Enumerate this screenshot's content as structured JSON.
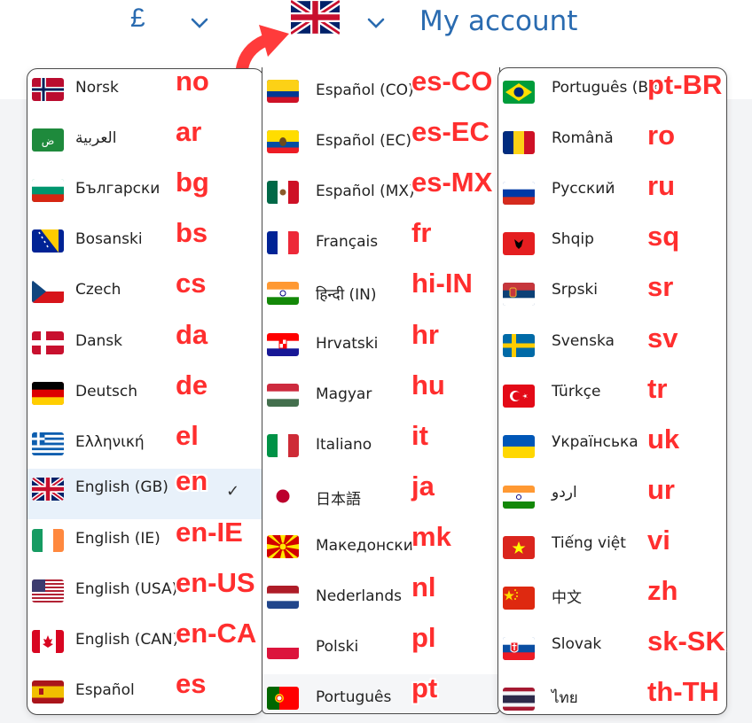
{
  "header": {
    "currency": "£",
    "account_label": "My account",
    "flag_icon": "uk-flag-icon",
    "accent_color": "#2a6bb0"
  },
  "annotation_color": "#ff2e2e",
  "columns": [
    {
      "items": [
        {
          "label": "Norsk",
          "code": "no",
          "flag": "no"
        },
        {
          "label": "العربية",
          "code": "ar",
          "flag": "ar"
        },
        {
          "label": "Български",
          "code": "bg",
          "flag": "bg"
        },
        {
          "label": "Bosanski",
          "code": "bs",
          "flag": "bs"
        },
        {
          "label": "Czech",
          "code": "cs",
          "flag": "cs"
        },
        {
          "label": "Dansk",
          "code": "da",
          "flag": "da"
        },
        {
          "label": "Deutsch",
          "code": "de",
          "flag": "de"
        },
        {
          "label": "Ελληνική",
          "code": "el",
          "flag": "el"
        },
        {
          "label": "English (GB)",
          "code": "en",
          "flag": "gb",
          "selected": true
        },
        {
          "label": "English (IE)",
          "code": "en-IE",
          "flag": "ie"
        },
        {
          "label": "English (USA)",
          "code": "en-US",
          "flag": "us"
        },
        {
          "label": "English (CAN)",
          "code": "en-CA",
          "flag": "ca"
        },
        {
          "label": "Español",
          "code": "es",
          "flag": "es"
        }
      ]
    },
    {
      "items": [
        {
          "label": "Español (CO)",
          "code": "es-CO",
          "flag": "co"
        },
        {
          "label": "Español (EC)",
          "code": "es-EC",
          "flag": "ec"
        },
        {
          "label": "Español (MX)",
          "code": "es-MX",
          "flag": "mx"
        },
        {
          "label": "Français",
          "code": "fr",
          "flag": "fr"
        },
        {
          "label": "हिन्दी (IN)",
          "code": "hi-IN",
          "flag": "in"
        },
        {
          "label": "Hrvatski",
          "code": "hr",
          "flag": "hr"
        },
        {
          "label": "Magyar",
          "code": "hu",
          "flag": "hu"
        },
        {
          "label": "Italiano",
          "code": "it",
          "flag": "it"
        },
        {
          "label": "日本語",
          "code": "ja",
          "flag": "jp"
        },
        {
          "label": "Македонски",
          "code": "mk",
          "flag": "mk"
        },
        {
          "label": "Nederlands",
          "code": "nl",
          "flag": "nl"
        },
        {
          "label": "Polski",
          "code": "pl",
          "flag": "pl"
        },
        {
          "label": "Português",
          "code": "pt",
          "flag": "pt",
          "hover": true
        }
      ]
    },
    {
      "items": [
        {
          "label": "Português (BR)",
          "code": "pt-BR",
          "flag": "br"
        },
        {
          "label": "Română",
          "code": "ro",
          "flag": "ro"
        },
        {
          "label": "Русский",
          "code": "ru",
          "flag": "ru"
        },
        {
          "label": "Shqip",
          "code": "sq",
          "flag": "al"
        },
        {
          "label": "Srpski",
          "code": "sr",
          "flag": "rs"
        },
        {
          "label": "Svenska",
          "code": "sv",
          "flag": "se"
        },
        {
          "label": "Türkçe",
          "code": "tr",
          "flag": "tr"
        },
        {
          "label": "Українська",
          "code": "uk",
          "flag": "ua"
        },
        {
          "label": "اردو",
          "code": "ur",
          "flag": "pk"
        },
        {
          "label": "Tiếng việt",
          "code": "vi",
          "flag": "vn"
        },
        {
          "label": "中文",
          "code": "zh",
          "flag": "cn"
        },
        {
          "label": "Slovak",
          "code": "sk-SK",
          "flag": "sk"
        },
        {
          "label": "ไทย",
          "code": "th-TH",
          "flag": "th"
        }
      ]
    }
  ]
}
